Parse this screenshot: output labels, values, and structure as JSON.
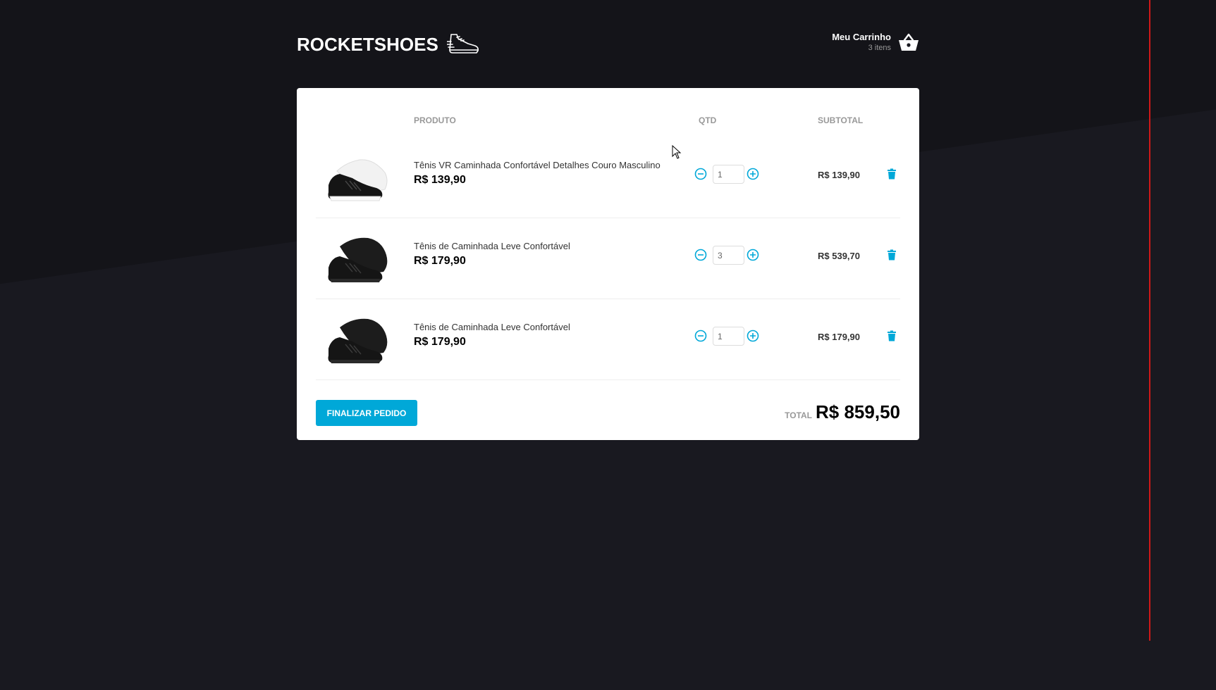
{
  "header": {
    "logo_text": "ROCKETSHOES",
    "cart_title": "Meu Carrinho",
    "cart_count": "3 itens"
  },
  "table": {
    "col_product": "PRODUTO",
    "col_qty": "QTD",
    "col_subtotal": "SUBTOTAL"
  },
  "items": [
    {
      "title": "Tênis VR Caminhada Confortável Detalhes Couro Masculino",
      "price": "R$ 139,90",
      "qty": "1",
      "subtotal": "R$ 139,90",
      "image": "white-sole-black-sneaker"
    },
    {
      "title": "Tênis de Caminhada Leve Confortável",
      "price": "R$ 179,90",
      "qty": "3",
      "subtotal": "R$ 539,70",
      "image": "black-sneaker"
    },
    {
      "title": "Tênis de Caminhada Leve Confortável",
      "price": "R$ 179,90",
      "qty": "1",
      "subtotal": "R$ 179,90",
      "image": "black-sneaker"
    }
  ],
  "footer": {
    "checkout_label": "FINALIZAR PEDIDO",
    "total_label": "TOTAL",
    "total_value": "R$ 859,50"
  },
  "colors": {
    "accent": "#00a8d8",
    "background": "#191920",
    "panel": "#ffffff"
  },
  "icons": {
    "logo": "sneaker-icon",
    "cart": "basket-icon",
    "minus": "remove-circle-icon",
    "plus": "add-circle-icon",
    "delete": "trash-icon"
  }
}
